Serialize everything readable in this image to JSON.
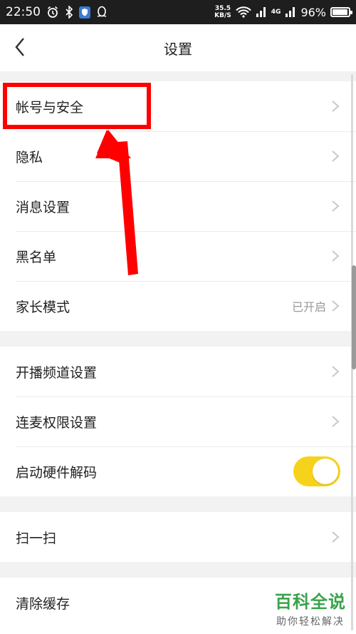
{
  "status_bar": {
    "time": "22:50",
    "net_speed_value": "35.5",
    "net_speed_unit": "KB/S",
    "network_type": "4G",
    "battery_percent": "96%",
    "battery_level": 0.96
  },
  "header": {
    "title": "设置"
  },
  "sections": [
    {
      "items": [
        {
          "label": "帐号与安全"
        },
        {
          "label": "隐私"
        },
        {
          "label": "消息设置"
        },
        {
          "label": "黑名单"
        },
        {
          "label": "家长模式",
          "value": "已开启"
        }
      ]
    },
    {
      "items": [
        {
          "label": "开播频道设置"
        },
        {
          "label": "连麦权限设置"
        },
        {
          "label": "启动硬件解码",
          "toggle_on": true
        }
      ]
    },
    {
      "items": [
        {
          "label": "扫一扫"
        }
      ]
    },
    {
      "items": [
        {
          "label": "清除缓存"
        }
      ]
    }
  ],
  "colors": {
    "toggle_on": "#f7d21a",
    "annotation": "#ff0000",
    "watermark": "#3aa24a"
  },
  "watermark": {
    "title": "百科全说",
    "subtitle": "助你轻松解决"
  }
}
